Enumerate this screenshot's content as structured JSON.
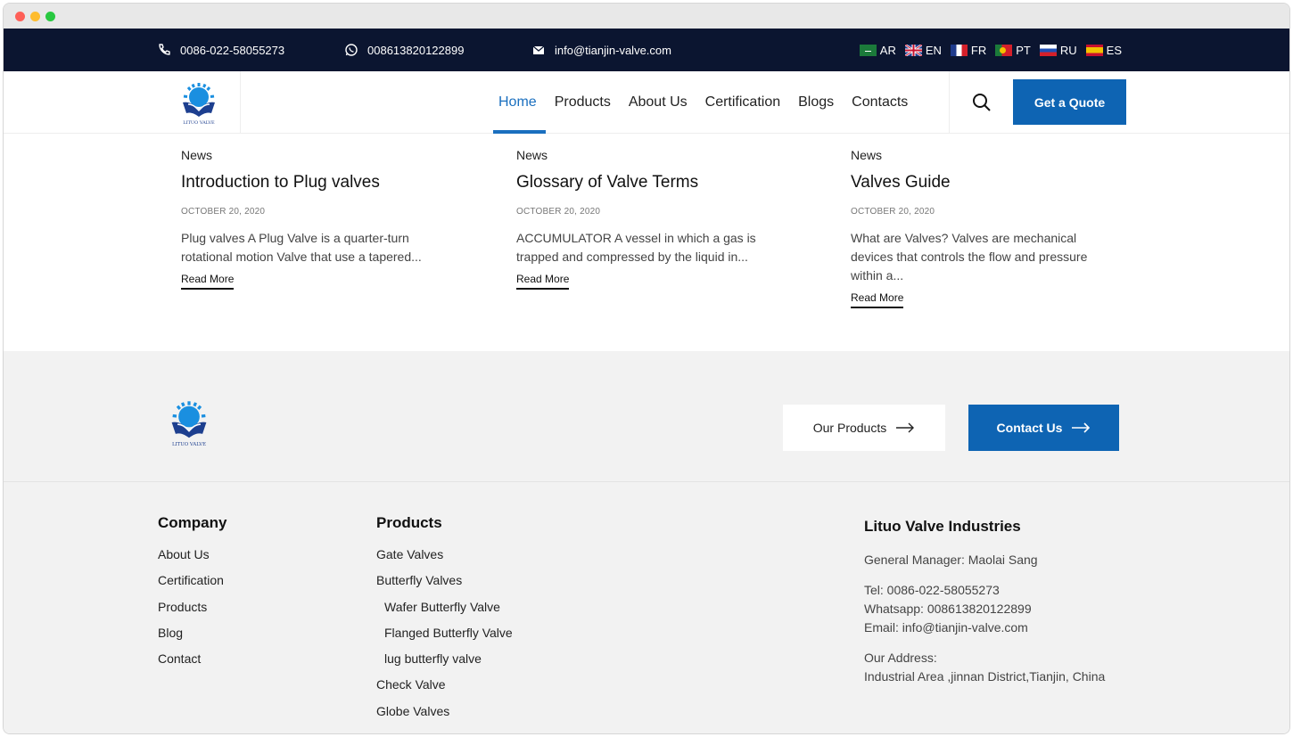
{
  "topbar": {
    "phone": "0086-022-58055273",
    "whatsapp": "008613820122899",
    "email": "info@tianjin-valve.com",
    "languages": [
      {
        "code": "AR"
      },
      {
        "code": "EN"
      },
      {
        "code": "FR"
      },
      {
        "code": "PT"
      },
      {
        "code": "RU"
      },
      {
        "code": "ES"
      }
    ]
  },
  "nav": {
    "links": [
      "Home",
      "Products",
      "About Us",
      "Certification",
      "Blogs",
      "Contacts"
    ],
    "active": "Home",
    "quote_label": "Get a Quote"
  },
  "news": [
    {
      "category": "News",
      "title": "Introduction to Plug valves",
      "date": "OCTOBER 20, 2020",
      "excerpt": "Plug valves A Plug Valve is a quarter-turn rotational motion Valve that use a tapered...",
      "read_more": "Read More"
    },
    {
      "category": "News",
      "title": "Glossary of Valve Terms",
      "date": "OCTOBER 20, 2020",
      "excerpt": "ACCUMULATOR A vessel in which a gas is trapped and compressed by the liquid in...",
      "read_more": "Read More"
    },
    {
      "category": "News",
      "title": "Valves Guide",
      "date": "OCTOBER 20, 2020",
      "excerpt": "What are Valves? Valves are mechanical devices that controls the flow and pressure within a...",
      "read_more": "Read More"
    }
  ],
  "cta": {
    "products_label": "Our Products",
    "contact_label": "Contact Us"
  },
  "footer": {
    "company": {
      "title": "Company",
      "items": [
        "About Us",
        "Certification",
        "Products",
        "Blog",
        "Contact"
      ]
    },
    "products": {
      "title": "Products",
      "items": [
        "Gate Valves",
        "Butterfly Valves",
        "Wafer Butterfly Valve",
        "Flanged Butterfly Valve",
        "lug butterfly valve",
        "Check Valve",
        "Globe Valves"
      ]
    },
    "contact": {
      "title": "Lituo Valve Industries",
      "manager": "General Manager:  Maolai Sang",
      "tel": "Tel: 0086-022-58055273",
      "whatsapp": "Whatsapp: 008613820122899",
      "email": "Email: info@tianjin-valve.com",
      "address_label": "Our Address:",
      "address": "Industrial Area ,jinnan District,Tianjin, China"
    }
  },
  "logo_text": "LITUO VALVE",
  "colors": {
    "brand_blue": "#0e64b3",
    "topbar_bg": "#0b1530",
    "footer_bg": "#f2f2f2"
  }
}
